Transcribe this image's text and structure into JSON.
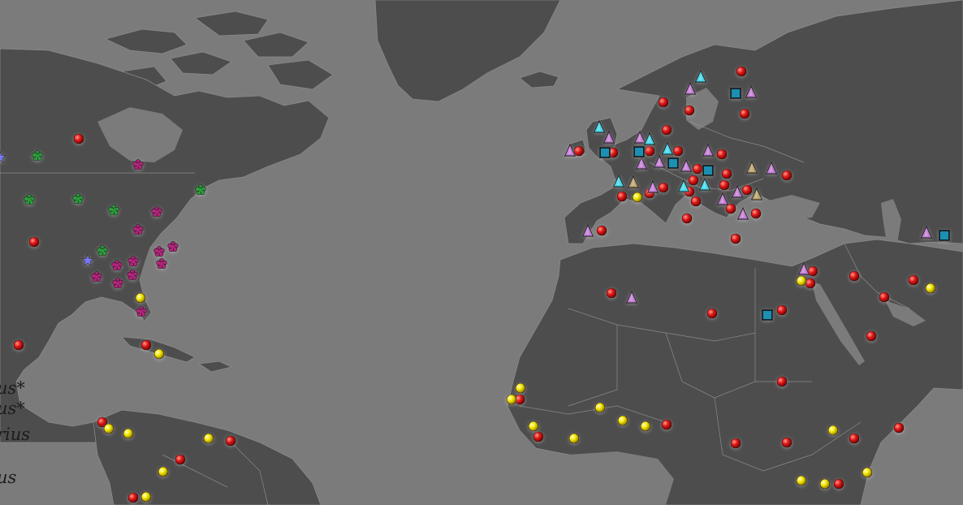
{
  "map": {
    "colors": {
      "ocean": "#7b7b7b",
      "land": "#4d4d4d",
      "border": "#9a9a9a",
      "marker_red": "#e01818",
      "marker_yellow": "#f2e600",
      "marker_violet": "#c07ad2",
      "marker_cyan": "#3fd6e8",
      "marker_olive": "#b8a068",
      "marker_square": "#1a8fb2",
      "marker_flower_magenta": "#b0257a",
      "marker_flower_green": "#2f9a3c",
      "marker_star_blue": "#7a7aff"
    },
    "legend_fragments": [
      "us*",
      "us*",
      "rius",
      "",
      "us"
    ]
  }
}
